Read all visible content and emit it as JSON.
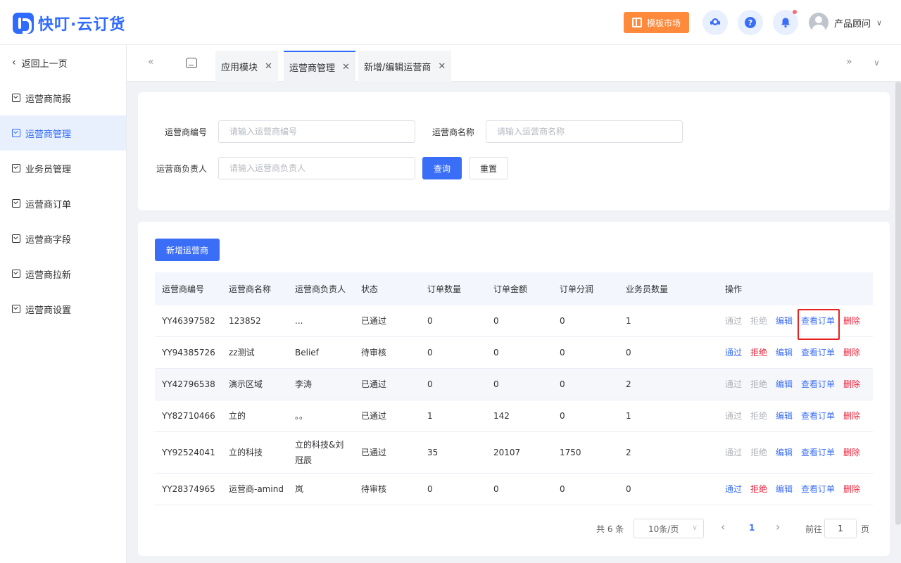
{
  "header": {
    "logo_text": "快叮·云订货",
    "market_label": "模板市场",
    "help_glyph": "?",
    "user_name": "产品顾问",
    "user_chevron": "∨"
  },
  "sidebar": {
    "back_label": "返回上一页",
    "items": [
      {
        "label": "运营商简报"
      },
      {
        "label": "运营商管理"
      },
      {
        "label": "业务员管理"
      },
      {
        "label": "运营商订单"
      },
      {
        "label": "运营商字段"
      },
      {
        "label": "运营商拉新"
      },
      {
        "label": "运营商设置"
      }
    ]
  },
  "tabs": {
    "prev": "«",
    "next": "»",
    "more": "∨",
    "items": [
      {
        "label": "应用模块"
      },
      {
        "label": "运营商管理"
      },
      {
        "label": "新增/编辑运营商"
      }
    ],
    "close": "✕"
  },
  "search": {
    "code_label": "运营商编号",
    "code_placeholder": "请输入运营商编号",
    "name_label": "运营商名称",
    "name_placeholder": "请输入运营商名称",
    "owner_label": "运营商负责人",
    "owner_placeholder": "请输入运营商负责人",
    "query_btn": "查询",
    "reset_btn": "重置"
  },
  "table": {
    "add_btn": "新增运营商",
    "columns": [
      "运营商编号",
      "运营商名称",
      "运营商负责人",
      "状态",
      "订单数量",
      "订单金额",
      "订单分润",
      "业务员数量",
      "操作"
    ],
    "ops": {
      "approve": "通过",
      "reject": "拒绝",
      "edit": "编辑",
      "view_orders": "查看订单",
      "delete": "删除"
    },
    "rows": [
      {
        "code": "YY46397582",
        "name": "123852",
        "owner": "...",
        "status": "已通过",
        "orders": "0",
        "amount": "0",
        "profit": "0",
        "staff": "1"
      },
      {
        "code": "YY94385726",
        "name": "zz测试",
        "owner": "Belief",
        "status": "待审核",
        "orders": "0",
        "amount": "0",
        "profit": "0",
        "staff": "0"
      },
      {
        "code": "YY42796538",
        "name": "演示区域",
        "owner": "李涛",
        "status": "已通过",
        "orders": "0",
        "amount": "0",
        "profit": "0",
        "staff": "2"
      },
      {
        "code": "YY82710466",
        "name": "立的",
        "owner": "。。",
        "status": "已通过",
        "orders": "1",
        "amount": "142",
        "profit": "0",
        "staff": "1"
      },
      {
        "code": "YY92524041",
        "name": "立的科技",
        "owner": "立的科技&刘冠辰",
        "status": "已通过",
        "orders": "35",
        "amount": "20107",
        "profit": "1750",
        "staff": "2"
      },
      {
        "code": "YY28374965",
        "name": "运营商-amind",
        "owner": "岚",
        "status": "待审核",
        "orders": "0",
        "amount": "0",
        "profit": "0",
        "staff": "0"
      }
    ]
  },
  "pagination": {
    "total_text": "共 6 条",
    "page_size": "10条/页",
    "page_size_chevron": "∨",
    "prev": "‹",
    "next": "›",
    "current_page": "1",
    "goto_label": "前往",
    "goto_value": "1",
    "page_suffix": "页"
  }
}
